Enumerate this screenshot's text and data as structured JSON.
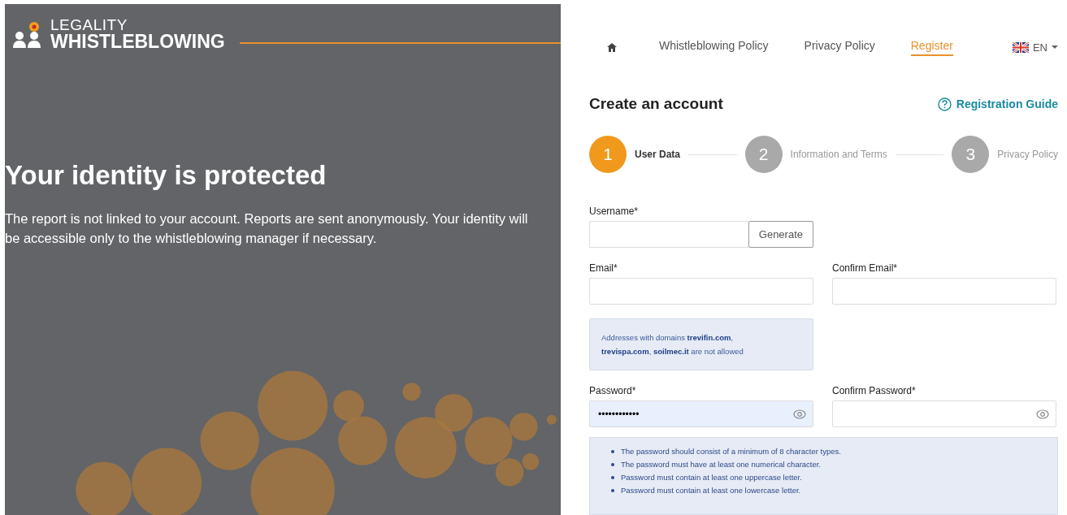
{
  "brand": {
    "line_1": "LEGALITY",
    "line_2": "WHISTLEBLOWING"
  },
  "hero": {
    "title": "Your identity is protected",
    "text": "The report is not linked to your account. Reports are sent anonymously. Your identity will be accessible only to the whistleblowing manager if necessary."
  },
  "nav": {
    "items": [
      {
        "label": "Whistleblowing Policy",
        "selected": false
      },
      {
        "label": "Privacy Policy",
        "selected": false
      },
      {
        "label": "Register",
        "selected": true
      }
    ],
    "language": "EN"
  },
  "heading": "Create an account",
  "guide_link": "Registration Guide",
  "steps": [
    {
      "number": "1",
      "label": "User Data",
      "selected": true
    },
    {
      "number": "2",
      "label": "Information and Terms",
      "selected": false
    },
    {
      "number": "3",
      "label": "Privacy Policy",
      "selected": false
    }
  ],
  "username": {
    "label": "Username*",
    "button": "Generate"
  },
  "email": {
    "label": "Email*",
    "confirm_label": "Confirm Email*",
    "note": "Addresses with domains **trevifin.com**, **trevispa.com**, **soilmec.it** are not allowed"
  },
  "password": {
    "label": "Password*",
    "value": "••••••••••••",
    "confirm_label": "Confirm Password*"
  },
  "rules": [
    "The password should consist of a minimum of 8 character types.",
    "The password must have at least one numerical character.",
    "Password must contain at least one uppercase letter.",
    "Password must contain at least one lowercase letter."
  ]
}
